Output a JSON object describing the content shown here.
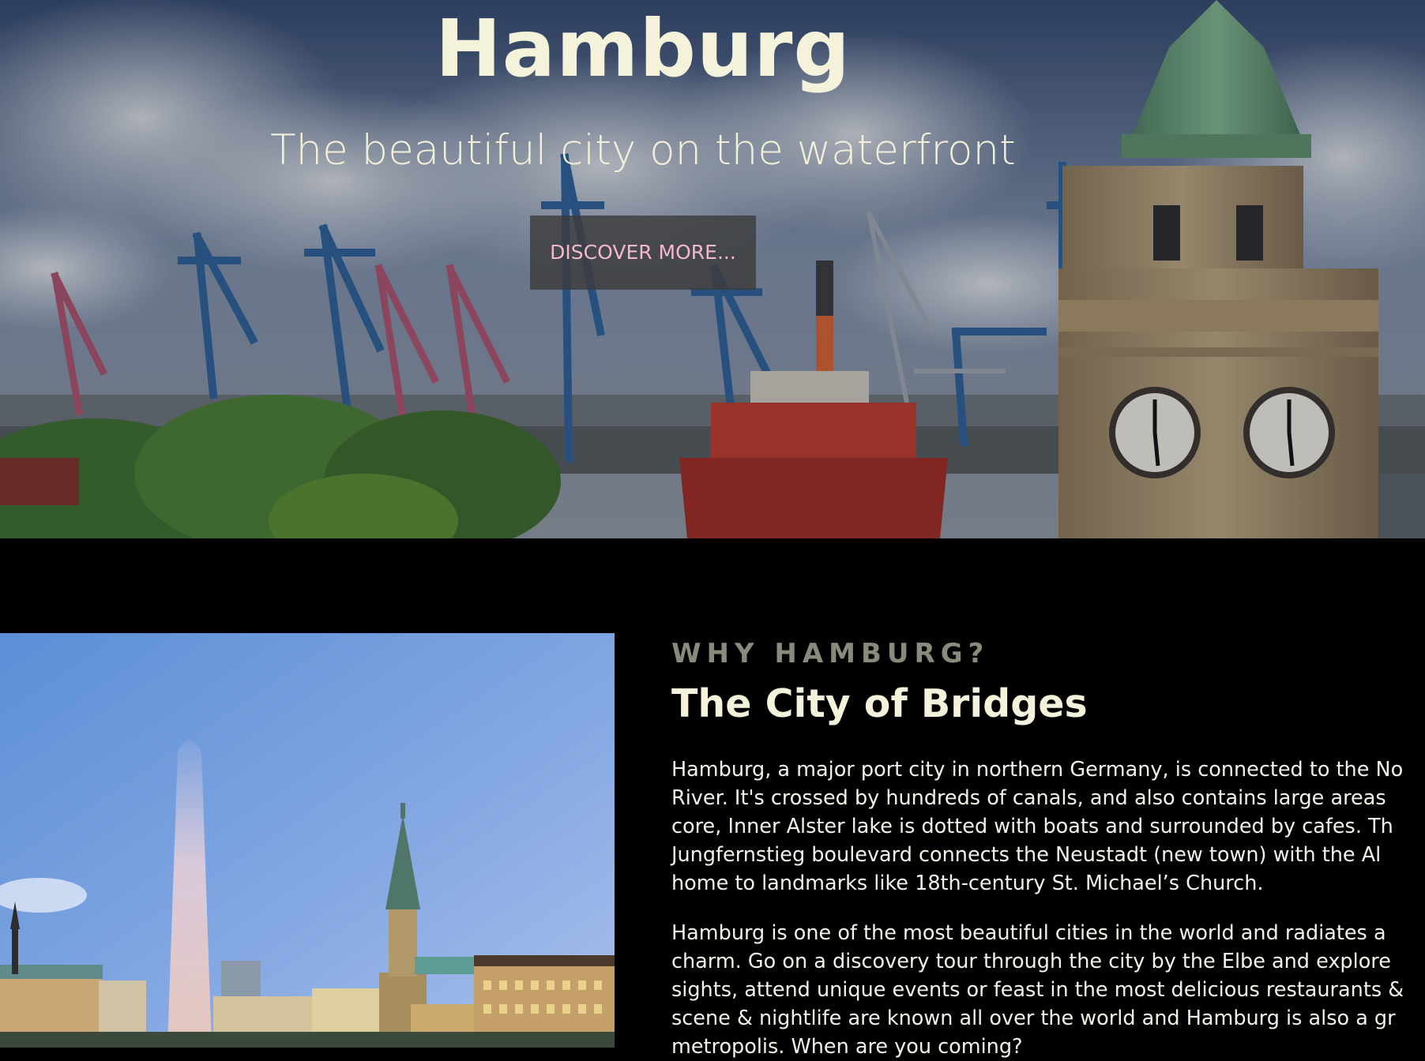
{
  "hero": {
    "title": "Hamburg",
    "subtitle": "The beautiful city on the waterfront",
    "cta_label": "DISCOVER MORE..."
  },
  "section": {
    "eyebrow": "WHY HAMBURG?",
    "title": "The City of Bridges",
    "paragraph_1_lines": [
      "Hamburg, a major port city in northern Germany, is connected to the No",
      "River. It's crossed by hundreds of canals, and also contains large areas",
      "core, Inner Alster lake is dotted with boats and surrounded by cafes. Th",
      "Jungfernstieg boulevard connects the Neustadt (new town) with the Al",
      "home to landmarks like 18th-century St. Michael’s Church."
    ],
    "paragraph_2_lines": [
      "Hamburg is one of the most beautiful cities in the world and radiates a",
      "charm. Go on a discovery tour through the city by the Elbe and explore",
      "sights, attend unique events or feast in the most delicious restaurants &",
      "scene & nightlife are known all over the world and Hamburg is also a gr",
      "metropolis. When are you coming?"
    ]
  },
  "colors": {
    "background": "#000000",
    "hero_title": "#f5f2dc",
    "cta_text": "#f3b8d0",
    "eyebrow": "#8a8a7a"
  }
}
